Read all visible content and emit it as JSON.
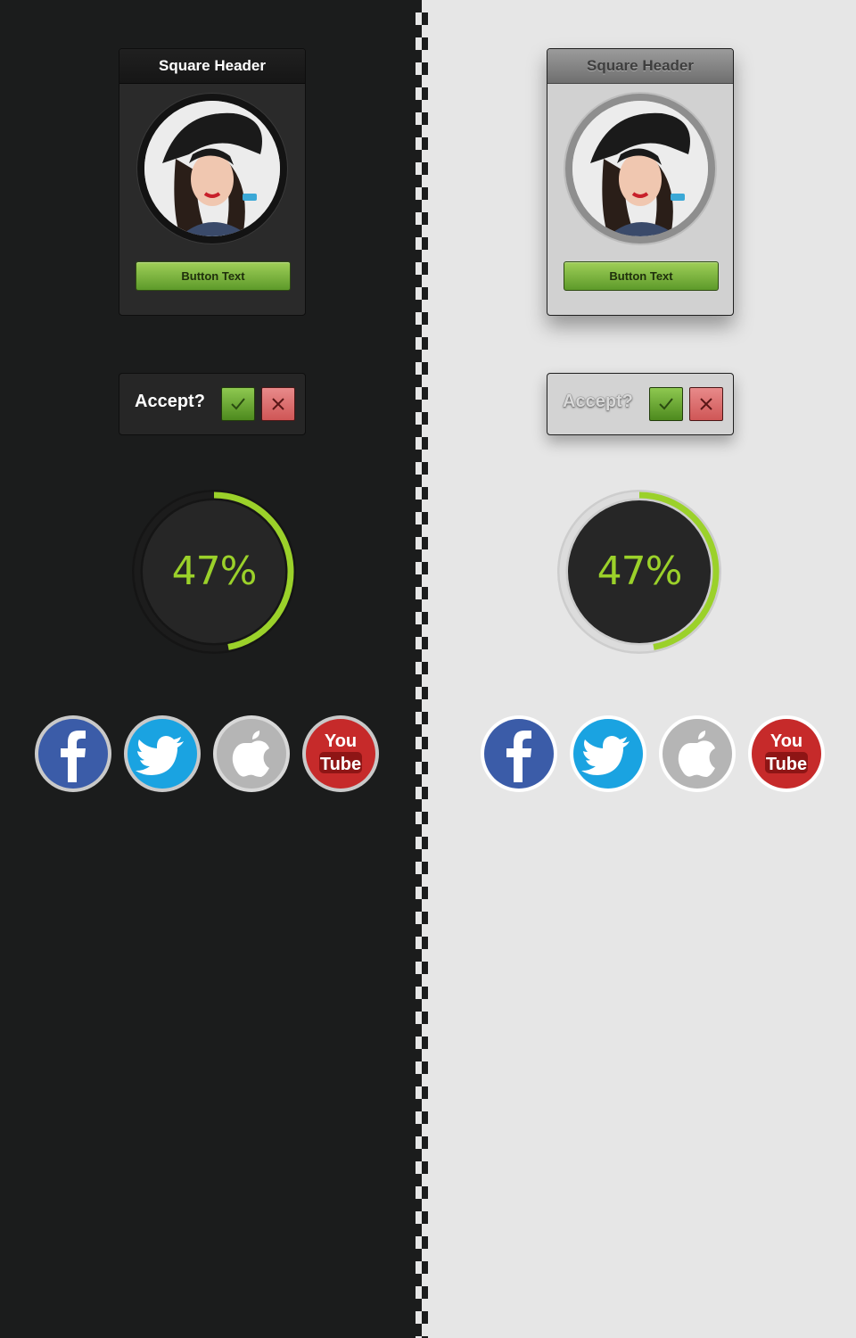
{
  "colors": {
    "dark_bg": "#1b1c1c",
    "light_bg": "#e6e6e6",
    "accent_green": "#9bd12a",
    "button_green": "#6fa833",
    "reject_red": "#d85f5f"
  },
  "themes": {
    "dark": {
      "card": {
        "header": "Square Header",
        "avatar_icon": "profile-photo",
        "button_label": "Button Text"
      },
      "accept": {
        "label": "Accept?",
        "ok_icon": "check-icon",
        "cancel_icon": "close-icon"
      },
      "progress": {
        "label": "47%",
        "value": 0.47
      },
      "social": [
        {
          "name": "facebook-icon",
          "label": "f"
        },
        {
          "name": "twitter-icon",
          "label": "twitter"
        },
        {
          "name": "apple-icon",
          "label": "apple"
        },
        {
          "name": "youtube-icon",
          "label": "You Tube"
        }
      ]
    },
    "light": {
      "card": {
        "header": "Square Header",
        "avatar_icon": "profile-photo",
        "button_label": "Button Text"
      },
      "accept": {
        "label": "Accept?",
        "ok_icon": "check-icon",
        "cancel_icon": "close-icon"
      },
      "progress": {
        "label": "47%",
        "value": 0.47
      },
      "social": [
        {
          "name": "facebook-icon",
          "label": "f"
        },
        {
          "name": "twitter-icon",
          "label": "twitter"
        },
        {
          "name": "apple-icon",
          "label": "apple"
        },
        {
          "name": "youtube-icon",
          "label": "You Tube"
        }
      ]
    }
  },
  "youtube_text": {
    "top": "You",
    "bottom": "Tube"
  }
}
